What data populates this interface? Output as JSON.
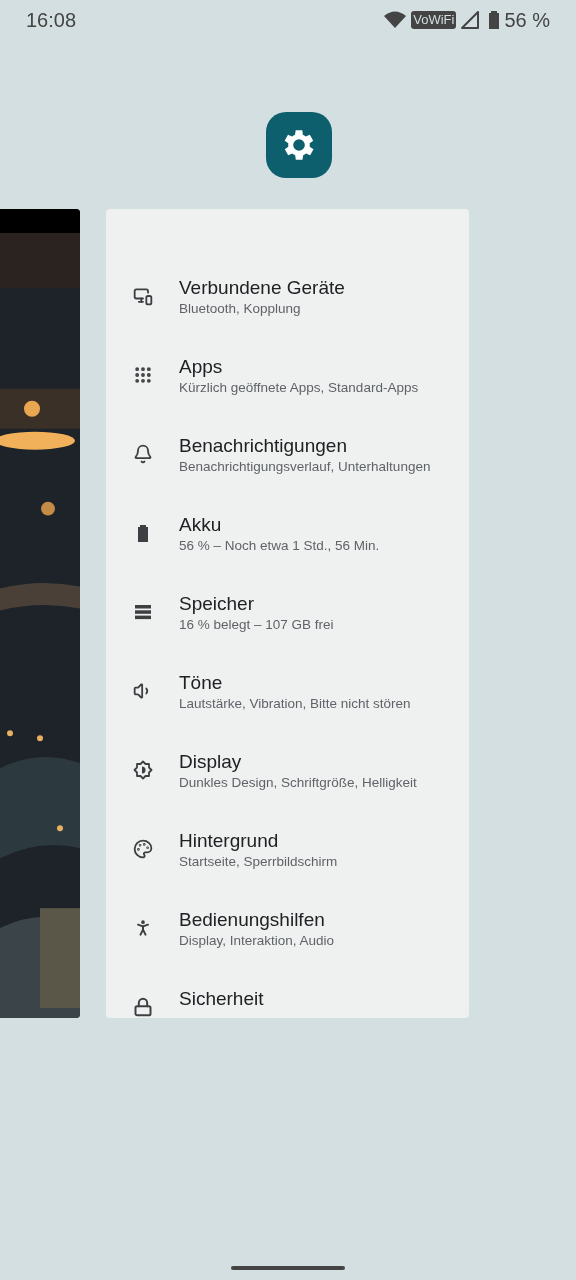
{
  "status_bar": {
    "time": "16:08",
    "wifi_calling": "VoWiFi",
    "battery": "56 %"
  },
  "recent_apps": [
    {
      "kind": "picture"
    },
    {
      "kind": "settings",
      "items": [
        {
          "kind": "devices",
          "title": "Verbundene Geräte",
          "subtitle": "Bluetooth, Kopplung"
        },
        {
          "kind": "apps",
          "title": "Apps",
          "subtitle": "Kürzlich geöffnete Apps, Standard-Apps"
        },
        {
          "kind": "notifications",
          "title": "Benachrichtigungen",
          "subtitle": "Benachrichtigungsverlauf, Unterhaltungen"
        },
        {
          "kind": "battery",
          "title": "Akku",
          "subtitle": "56 % – Noch etwa 1 Std., 56 Min."
        },
        {
          "kind": "storage",
          "title": "Speicher",
          "subtitle": "16 % belegt – 107 GB frei"
        },
        {
          "kind": "sound",
          "title": "Töne",
          "subtitle": "Lautstärke, Vibration, Bitte nicht stören"
        },
        {
          "kind": "display",
          "title": "Display",
          "subtitle": "Dunkles Design, Schriftgröße, Helligkeit"
        },
        {
          "kind": "wallpaper",
          "title": "Hintergrund",
          "subtitle": "Startseite, Sperrbildschirm"
        },
        {
          "kind": "accessibility",
          "title": "Bedienungshilfen",
          "subtitle": "Display, Interaktion, Audio"
        },
        {
          "kind": "security",
          "title": "Sicherheit"
        }
      ]
    }
  ]
}
